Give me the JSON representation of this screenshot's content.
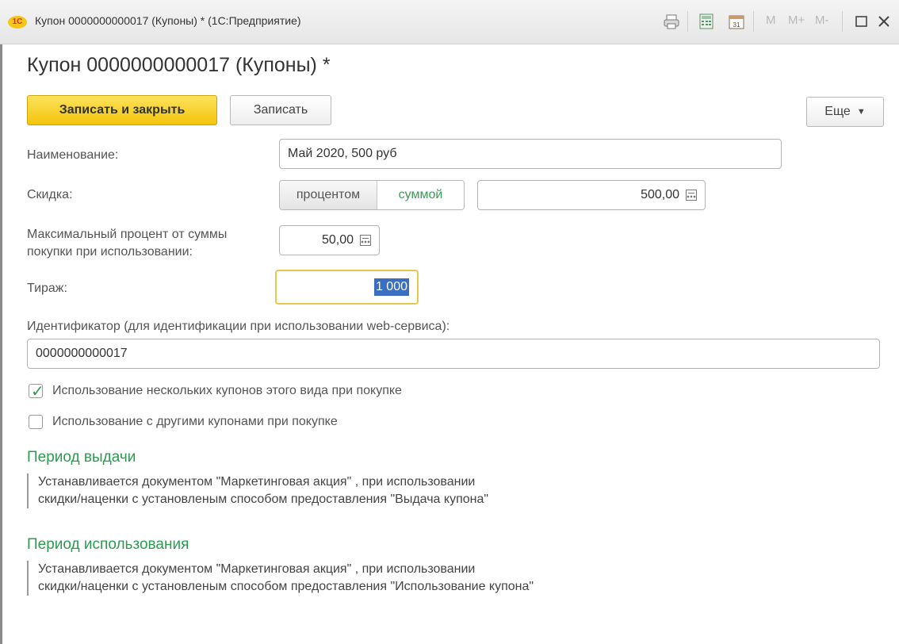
{
  "window": {
    "title": "Купон 0000000000017 (Купоны) * (1С:Предприятие)",
    "toolbar": {
      "m": "M",
      "mplus": "M+",
      "mminus": "M-",
      "calendar_day": "31"
    }
  },
  "form": {
    "title": "Купон 0000000000017 (Купоны) *",
    "buttons": {
      "save_close": "Записать и закрыть",
      "save": "Записать",
      "more": "Еще"
    },
    "name": {
      "label": "Наименование:",
      "value": "Май 2020, 500 руб"
    },
    "discount": {
      "label": "Скидка:",
      "options": [
        "процентом",
        "суммой"
      ],
      "selected": "суммой",
      "value": "500,00"
    },
    "max_percent": {
      "label_line1": "Максимальный процент от суммы",
      "label_line2": "покупки при использовании:",
      "value": "50,00"
    },
    "circulation": {
      "label": "Тираж:",
      "value": "1 000"
    },
    "identifier": {
      "label": "Идентификатор (для идентификации при использовании web-сервиса):",
      "value": "0000000000017"
    },
    "checkboxes": [
      {
        "label": "Использование нескольких купонов этого вида при покупке",
        "checked": true
      },
      {
        "label": "Использование с другими купонами при покупке",
        "checked": false
      }
    ],
    "sections": [
      {
        "title": "Период выдачи",
        "line1": "Устанавливается документом \"Маркетинговая акция\" , при использовании",
        "line2": "скидки/наценки с установленым способом предоставления \"Выдача купона\""
      },
      {
        "title": "Период использования",
        "line1": "Устанавливается документом \"Маркетинговая акция\" , при использовании",
        "line2": "скидки/наценки с установленым способом предоставления \"Использование купона\""
      }
    ]
  },
  "colors": {
    "accent_green": "#2e9a4f",
    "primary_button": "#f2c40b",
    "selection": "#3a6fc0"
  }
}
